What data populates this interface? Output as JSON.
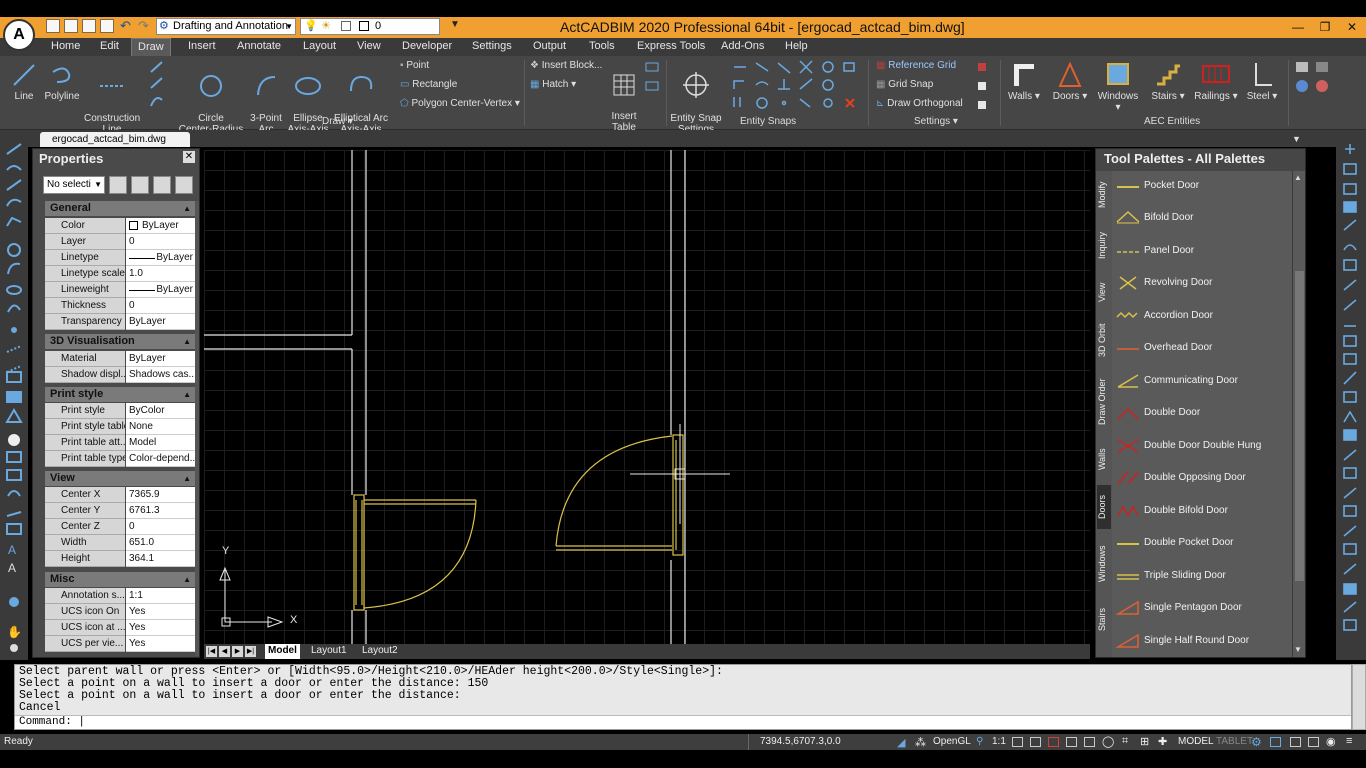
{
  "app": {
    "title": "ActCADBIM 2020 Professional 64bit - [ergocad_actcad_bim.dwg]",
    "logo_letter": "A",
    "workspace": "Drafting and Annotation",
    "layer_value": "0"
  },
  "menu": [
    "Home",
    "Edit",
    "Draw",
    "Insert",
    "Annotate",
    "Layout",
    "View",
    "Developer",
    "Settings",
    "Output",
    "Tools",
    "Express Tools",
    "Add-Ons",
    "Help"
  ],
  "ribbon": {
    "draw_buttons": [
      "Line",
      "Polyline",
      "Construction\nLine",
      "Circle\nCenter-Radius",
      "3-Point\nArc",
      "Ellipse\nAxis-Axis",
      "Elliptical Arc\nAxis-Axis"
    ],
    "draw_rows": [
      "Point",
      "Rectangle",
      "Polygon Center-Vertex"
    ],
    "insert_rows": [
      "Insert Block...",
      "Hatch"
    ],
    "insert_table": "Insert\nTable",
    "entity_snap_settings": "Entity Snap\nSettings",
    "settings_rows": [
      "Reference Grid",
      "Grid Snap",
      "Draw Orthogonal"
    ],
    "aec_buttons": [
      "Walls",
      "Doors",
      "Windows",
      "Stairs",
      "Railings",
      "Steel"
    ],
    "groups": {
      "draw": "Draw",
      "entity_snaps": "Entity Snaps",
      "settings": "Settings",
      "aec": "AEC Entities"
    }
  },
  "doc_tab": "ergocad_actcad_bim.dwg",
  "properties": {
    "title": "Properties",
    "selection": "No selecti",
    "sections": [
      {
        "name": "General",
        "rows": [
          [
            "Color",
            "ByLayer"
          ],
          [
            "Layer",
            "0"
          ],
          [
            "Linetype",
            "ByLayer"
          ],
          [
            "Linetype scale",
            "1.0"
          ],
          [
            "Lineweight",
            "ByLayer"
          ],
          [
            "Thickness",
            "0"
          ],
          [
            "Transparency",
            "ByLayer"
          ]
        ]
      },
      {
        "name": "3D Visualisation",
        "rows": [
          [
            "Material",
            "ByLayer"
          ],
          [
            "Shadow displ...",
            "Shadows cas..."
          ]
        ]
      },
      {
        "name": "Print style",
        "rows": [
          [
            "Print style",
            "ByColor"
          ],
          [
            "Print style table",
            "None"
          ],
          [
            "Print table att...",
            "Model"
          ],
          [
            "Print table type",
            "Color-depend..."
          ]
        ]
      },
      {
        "name": "View",
        "rows": [
          [
            "Center X",
            "7365.9"
          ],
          [
            "Center Y",
            "6761.3"
          ],
          [
            "Center Z",
            "0"
          ],
          [
            "Width",
            "651.0"
          ],
          [
            "Height",
            "364.1"
          ]
        ]
      },
      {
        "name": "Misc",
        "rows": [
          [
            "Annotation s...",
            "1:1"
          ],
          [
            "UCS icon On",
            "Yes"
          ],
          [
            "UCS icon at ...",
            "Yes"
          ],
          [
            "UCS per vie...",
            "Yes"
          ]
        ]
      }
    ]
  },
  "canvas": {
    "ucs_y": "Y",
    "ucs_x": "X"
  },
  "layout_tabs": [
    "Model",
    "Layout1",
    "Layout2"
  ],
  "palette": {
    "title": "Tool Palettes - All Palettes",
    "tabs": [
      "Modify",
      "Inquiry",
      "View",
      "3D Orbit",
      "Draw Order",
      "Walls",
      "Doors",
      "Windows",
      "Stairs"
    ],
    "active_tab": "Doors",
    "items": [
      "Pocket Door",
      "Bifold Door",
      "Panel Door",
      "Revolving Door",
      "Accordion Door",
      "Overhead Door",
      "Communicating Door",
      "Double Door",
      "Double Door Double Hung",
      "Double Opposing Door",
      "Double Bifold Door",
      "Double Pocket Door",
      "Triple Sliding Door",
      "Single Pentagon Door",
      "Single Half Round Door"
    ]
  },
  "command": {
    "lines": [
      "Select parent wall or press <Enter> or [Width<95.0>/Height<210.0>/HEAder height<200.0>/Style<Single>]:",
      "Select a point on a wall to insert a door or enter the distance: 150",
      "Select a point on a wall to insert a door or enter the distance:",
      "Cancel"
    ],
    "prompt": "Command:"
  },
  "status": {
    "state": "Ready",
    "coords": "7394.5,6707.3,0.0",
    "renderer": "OpenGL",
    "scale": "1:1",
    "model": "MODEL",
    "tablet": "TABLET"
  },
  "colors": {
    "titlebar": "#f0a030",
    "door_yellow": "#d9c24a",
    "wall_white": "#e8e8e8",
    "accent_blue": "#6aa8e0"
  }
}
